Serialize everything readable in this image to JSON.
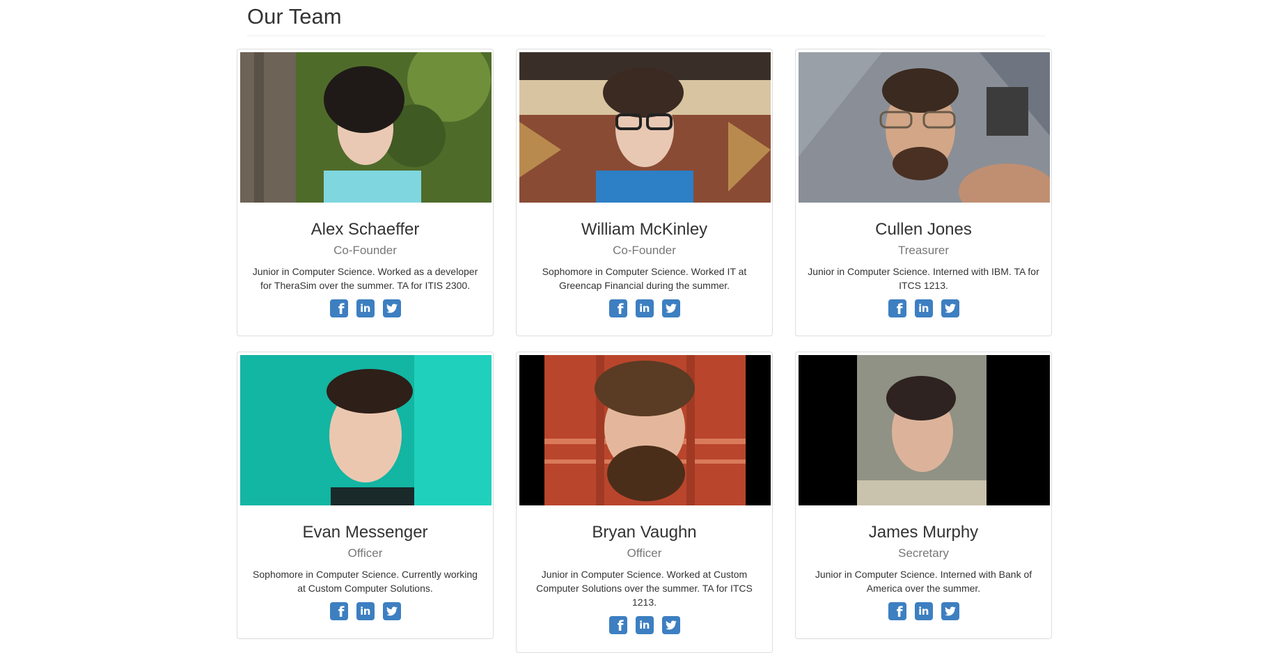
{
  "page": {
    "title": "Our Team"
  },
  "icons": {
    "facebook": "facebook-icon",
    "linkedin": "linkedin-icon",
    "twitter": "twitter-icon"
  },
  "colors": {
    "social_icon": "#3d7fc1",
    "role_text": "#777777",
    "card_border": "#dddddd"
  },
  "members": [
    {
      "name": "Alex Schaeffer",
      "role": "Co-Founder",
      "bio": "Junior in Computer Science. Worked as a developer for TheraSim over the summer. TA for ITIS 2300."
    },
    {
      "name": "William McKinley",
      "role": "Co-Founder",
      "bio": "Sophomore in Computer Science. Worked IT at Greencap Financial during the summer."
    },
    {
      "name": "Cullen Jones",
      "role": "Treasurer",
      "bio": "Junior in Computer Science. Interned with IBM. TA for ITCS 1213."
    },
    {
      "name": "Evan Messenger",
      "role": "Officer",
      "bio": "Sophomore in Computer Science. Currently working at Custom Computer Solutions."
    },
    {
      "name": "Bryan Vaughn",
      "role": "Officer",
      "bio": "Junior in Computer Science. Worked at Custom Computer Solutions over the summer. TA for ITCS 1213."
    },
    {
      "name": "James Murphy",
      "role": "Secretary",
      "bio": "Junior in Computer Science. Interned with Bank of America over the summer."
    }
  ]
}
